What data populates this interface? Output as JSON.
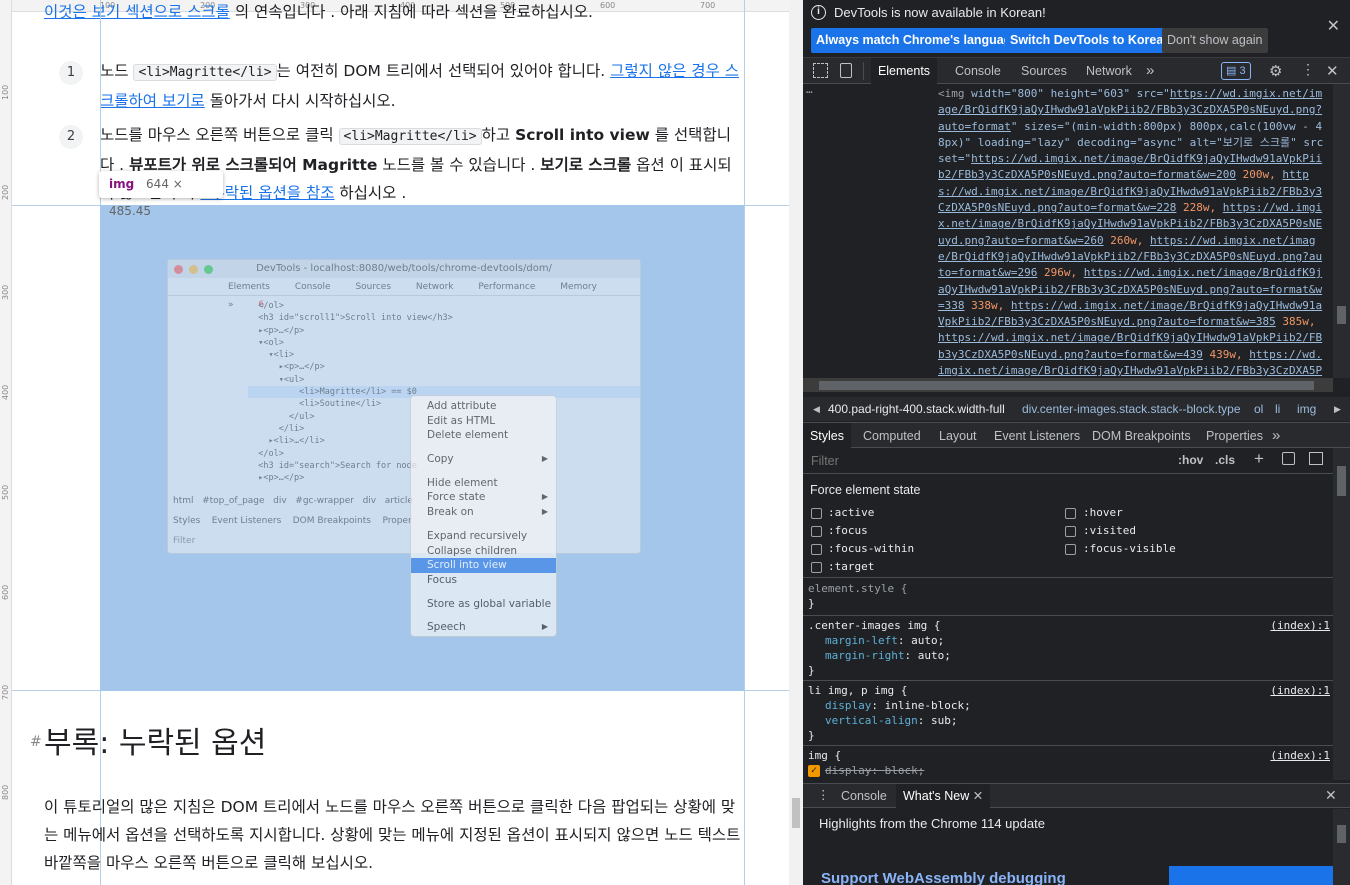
{
  "page": {
    "top_line": {
      "link": "이것은 보기 섹션으로 스크롤",
      "rest": "의 연속입니다 . 아래 지침에 따라 섹션을 완료하십시오."
    },
    "steps": [
      {
        "num": "1",
        "pre": "노드",
        "code": "<li>Magritte</li>",
        "mid": "는 여전히 DOM 트리에서 선택되어 있어야 합니다.",
        "link": "그렇지 않은 경우 스크롤하여 보기로",
        "post": "돌아가서 다시 시작하십시오."
      },
      {
        "num": "2",
        "pre": "노드를 마우스 오른쪽 버튼으로 클릭",
        "code": "<li>Magritte</li>",
        "mid1": "하고",
        "bold1": "Scroll into view",
        "mid2": "를 선택합니다 .",
        "bold2": "뷰포트가 위로 스크롤되어 Magritte",
        "mid3": "노드를 볼 수 있습니다 .",
        "bold3": "보기로 스크롤",
        "mid4": "옵션",
        "hidden": "이 표시되지 않으면",
        "mid5": "부록",
        "link": ": 누락된 옵션을 참조",
        "post": "하십시오 ."
      }
    ],
    "tooltip": {
      "tag": "img",
      "dims": "644 × 485.45"
    },
    "screenshot": {
      "title": "DevTools - localhost:8080/web/tools/chrome-devtools/dom/",
      "tabs": [
        "Elements",
        "Console",
        "Sources",
        "Network",
        "Performance",
        "Memory",
        "»"
      ],
      "errors": "6",
      "code_lines": [
        "  </ol>",
        "  <h3 id=\"scroll1\">Scroll into view</h3>",
        "  ▸<p>…</p>",
        "  ▾<ol>",
        "    ▾<li>",
        "      ▸<p>…</p>",
        "      ▾<ul>",
        "          <li>Magritte</li> == $0",
        "          <li>Soutine</li>",
        "        </ul>",
        "      </li>",
        "    ▸<li>…</li>",
        "  </ol>",
        "  <h3 id=\"search\">Search for node",
        "  ▸<p>…</p>"
      ],
      "crumbs": [
        "html",
        "#top_of_page",
        "div",
        "#gc-wrapper",
        "div",
        "article"
      ],
      "bottom_tabs": [
        "Styles",
        "Event Listeners",
        "DOM Breakpoints",
        "Proper"
      ],
      "filter": "Filter",
      "context_menu": [
        "Add attribute",
        "Edit as HTML",
        "Delete element",
        "-",
        "Copy",
        "-",
        "Hide element",
        "Force state",
        "Break on",
        "-",
        "Expand recursively",
        "Collapse children",
        "Scroll into view",
        "Focus",
        "-",
        "Store as global variable",
        "-",
        "Speech"
      ]
    },
    "heading": "부록: 누락된 옵션",
    "paragraph": "이 튜토리얼의 많은 지침은 DOM 트리에서 노드를 마우스 오른쪽 버튼으로 클릭한 다음 팝업되는 상황에 맞는 메뉴에서 옵션을 선택하도록 지시합니다. 상황에 맞는 메뉴에 지정된 옵션이 표시되지 않으면 노드 텍스트 바깥쪽을 마우스 오른쪽 버튼으로 클릭해 보십시오.",
    "ruler_top": [
      "100",
      "200",
      "300",
      "400",
      "500",
      "600",
      "700"
    ],
    "ruler_left": [
      "100",
      "200",
      "300",
      "400",
      "500",
      "600",
      "700",
      "800"
    ]
  },
  "devtools": {
    "infobar": {
      "message": "DevTools is now available in Korean!",
      "btn1": "Always match Chrome's language",
      "btn2": "Switch DevTools to Korean",
      "btn3": "Don't show again"
    },
    "tabs": [
      "Elements",
      "Console",
      "Sources",
      "Network"
    ],
    "more": "»",
    "issues": "3",
    "element_html": {
      "ellipsis": "…",
      "tag_open": "<img",
      "attrs1": " width=\"800\" height=\"603\" src=\"",
      "src": "https://wd.imgix.net/image/BrQidfK9jaQyIHwdw91aVpkPiib2/FBb3y3CzDXA5P0sNEuyd.png?auto=format",
      "attrs2": "\" sizes=\"(min-width:800px) 800px,calc(100vw - 48px)\" loading=\"lazy\" decoding=\"async\" alt=\"보기로 스크롤\"",
      "srcset_label": "srcset=\"",
      "srcset": [
        {
          "url": "https://wd.imgix.net/image/BrQidfK9jaQyIHwdw91aVpkPiib2/FBb3y3CzDXA5P0sNEuyd.png?auto=format&w=200",
          "w": "200w"
        },
        {
          "url": "https://wd.imgix.net/image/BrQidfK9jaQyIHwdw91aVpkPiib2/FBb3y3CzDXA5P0sNEuyd.png?auto=format&w=228",
          "w": "228w"
        },
        {
          "url": "https://wd.imgix.net/image/BrQidfK9jaQyIHwdw91aVpkPiib2/FBb3y3CzDXA5P0sNEuyd.png?auto=format&w=260",
          "w": "260w"
        },
        {
          "url": "https://wd.imgix.net/image/BrQidfK9jaQyIHwdw91aVpkPiib2/FBb3y3CzDXA5P0sNEuyd.png?auto=format&w=296",
          "w": "296w"
        },
        {
          "url": "https://wd.imgix.net/image/BrQidfK9jaQyIHwdw91aVpkPiib2/FBb3y3CzDXA5P0sNEuyd.png?auto=format&w=338",
          "w": "338w"
        },
        {
          "url": "https://wd.imgix.net/image/BrQidfK9jaQyIHwdw91aVpkPiib2/FBb3y3CzDXA5P0sNEuyd.png?auto=format&w=385",
          "w": "385w"
        },
        {
          "url": "https://wd.imgix.net/image/BrQidfK9jaQyIHwdw91aVpkPiib2/FBb3y3CzDXA5P0sNEuyd.png?auto=format&w=439",
          "w": "439w"
        },
        {
          "url": "https://wd.imgix.net/image/BrQidfK9jaQyIHwdw91aVpkPiib2/FBb3y3CzDXA5P0sNEuyd.pn",
          "w": ""
        }
      ]
    },
    "breadcrumb": [
      "400.pad-right-400.stack.width-full",
      "div.center-images.stack.stack--block.type",
      "ol",
      "li",
      "img"
    ],
    "subtabs": [
      "Styles",
      "Computed",
      "Layout",
      "Event Listeners",
      "DOM Breakpoints",
      "Properties",
      "»"
    ],
    "filter_placeholder": "Filter",
    "hov": ":hov",
    "cls": ".cls",
    "force_state_title": "Force element state",
    "states_left": [
      ":active",
      ":focus",
      ":focus-within",
      ":target"
    ],
    "states_right": [
      ":hover",
      ":visited",
      ":focus-visible"
    ],
    "rules": [
      {
        "selector": "element.style {",
        "decls": [],
        "close": "}",
        "src": ""
      },
      {
        "selector": ".center-images img {",
        "decls": [
          {
            "p": "margin-left",
            "v": "auto;"
          },
          {
            "p": "margin-right",
            "v": "auto;"
          }
        ],
        "close": "}",
        "src": "(index):1"
      },
      {
        "selector": "li img, p img {",
        "decls": [
          {
            "p": "display",
            "v": "inline-block;"
          },
          {
            "p": "vertical-align",
            "v": "sub;"
          }
        ],
        "close": "}",
        "src": "(index):1"
      },
      {
        "selector": "img {",
        "decls": [
          {
            "p": "display",
            "v": "block;"
          }
        ],
        "close": "",
        "src": "(index):1"
      }
    ],
    "drawer": {
      "tabs": [
        "Console",
        "What's New"
      ],
      "headline": "Highlights from the Chrome 114 update",
      "feature": "Support WebAssembly debugging"
    },
    "colors": {
      "bg": "#202124",
      "accent": "#8ab4f8",
      "button": "#1a73e8"
    }
  }
}
